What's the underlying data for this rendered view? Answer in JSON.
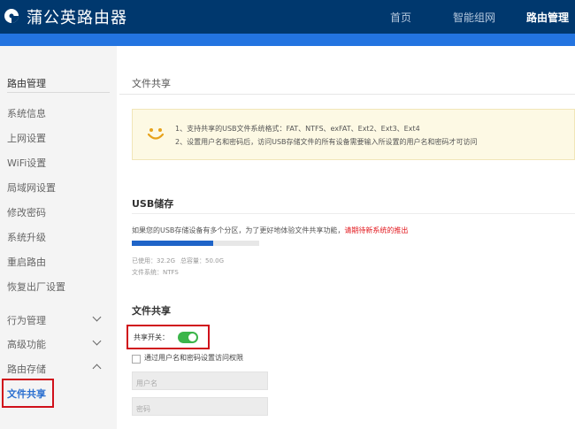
{
  "header": {
    "brand": "蒲公英路由器",
    "nav": [
      "首页",
      "智能组网",
      "路由管理"
    ]
  },
  "sidebar": {
    "title": "路由管理",
    "items": [
      "系统信息",
      "上网设置",
      "WiFi设置",
      "局域网设置",
      "修改密码",
      "系统升级",
      "重启路由",
      "恢复出厂设置"
    ],
    "groups": [
      "行为管理",
      "高级功能",
      "路由存储"
    ],
    "active_item": "文件共享"
  },
  "main": {
    "page_title": "文件共享",
    "notice": [
      "1、支持共享的USB文件系统格式：FAT、NTFS、exFAT、Ext2、Ext3、Ext4",
      "2、设置用户名和密码后，访问USB存储文件的所有设备需要输入所设置的用户名和密码才可访问"
    ],
    "usb": {
      "title": "USB储存",
      "desc": "如果您的USB存储设备有多个分区，为了更好地体验文件共享功能，",
      "warn": "请期待新系统的推出",
      "used_text": "已使用：32.2G",
      "capacity_text": "总容量：50.0G",
      "fs_text": "文件系统：NTFS",
      "used_fraction": 0.64
    },
    "share": {
      "title": "文件共享",
      "toggle_label": "共享开关：",
      "toggle_on": true,
      "checkbox_label": "通过用户名和密码设置访问权限",
      "username_placeholder": "用户名",
      "password_placeholder": "密码"
    }
  },
  "colors": {
    "header": "#00386e",
    "accent_bar": "#2374e0",
    "toggle": "#3bb54a",
    "warn": "#e2151b",
    "highlight_box": "#d0101a"
  }
}
